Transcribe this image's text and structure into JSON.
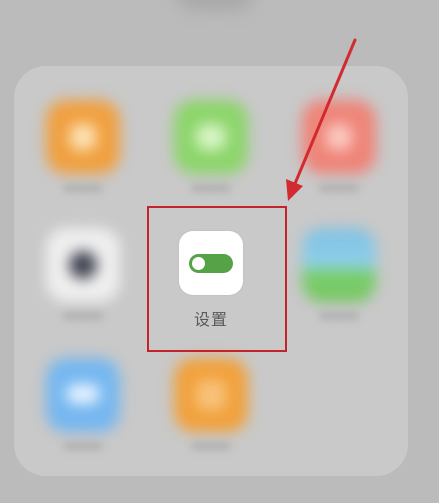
{
  "folder": {
    "highlighted_app": {
      "label": "设置",
      "icon": "toggle-switch-icon"
    },
    "blurred_apps": [
      {
        "color": "#f0a040",
        "icon": "unknown-app-icon"
      },
      {
        "color": "#8cd56a",
        "icon": "unknown-app-icon"
      },
      {
        "color": "#ef8478",
        "icon": "unknown-app-icon"
      },
      {
        "color": "#efefef",
        "icon": "camera-lens-icon"
      },
      {
        "color": "#7fc1e4",
        "icon": "landscape-icon"
      },
      {
        "color": "#75b7f0",
        "icon": "weather-icon"
      },
      {
        "color": "#f1a13c",
        "icon": "unknown-app-icon"
      }
    ]
  },
  "annotation": {
    "highlight_color": "#c4232d",
    "arrow_color": "#d22a2f"
  },
  "colors": {
    "toggle_on": "#56a246",
    "background": "#bbbbbb",
    "panel": "#c9c9c9"
  }
}
